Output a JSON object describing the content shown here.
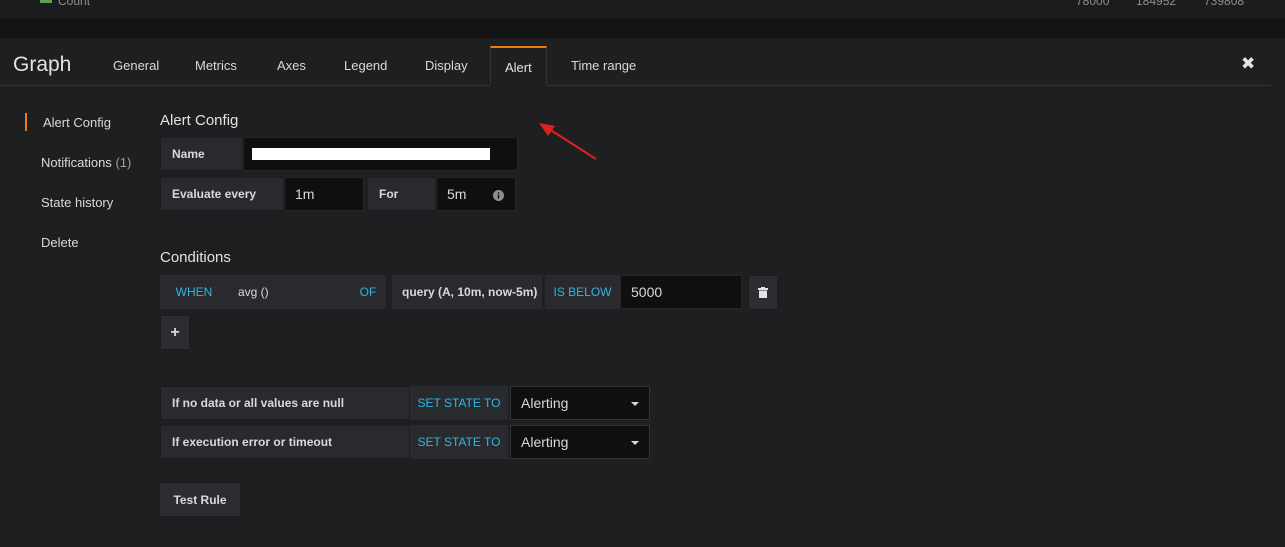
{
  "background_panel": {
    "legend_label": "Count",
    "stats": [
      "78000",
      "184952",
      "739808"
    ]
  },
  "editor": {
    "title": "Graph",
    "tabs": [
      "General",
      "Metrics",
      "Axes",
      "Legend",
      "Display",
      "Alert",
      "Time range"
    ],
    "active_tab": "Alert",
    "close_icon": "✖"
  },
  "sidebar": {
    "items": [
      {
        "label": "Alert Config",
        "count": ""
      },
      {
        "label": "Notifications",
        "count": "(1)"
      },
      {
        "label": "State history",
        "count": ""
      },
      {
        "label": "Delete",
        "count": ""
      }
    ]
  },
  "alert_config": {
    "title": "Alert Config",
    "name_label": "Name",
    "name_value": "",
    "evaluate_label": "Evaluate every",
    "evaluate_value": "1m",
    "for_label": "For",
    "for_value": "5m"
  },
  "conditions": {
    "title": "Conditions",
    "when": "WHEN",
    "reducer": "avg ()",
    "of": "OF",
    "query": "query (A, 10m, now-5m)",
    "evaluator": "IS BELOW",
    "threshold": "5000",
    "add_label": "+"
  },
  "no_data": {
    "label": "If no data or all values are null",
    "action": "SET STATE TO",
    "value": "Alerting"
  },
  "exec_error": {
    "label": "If execution error or timeout",
    "action": "SET STATE TO",
    "value": "Alerting"
  },
  "test_rule": "Test Rule",
  "colors": {
    "accent": "#eb7b18",
    "keyword": "#33b5e5",
    "annotation": "#e02020"
  }
}
